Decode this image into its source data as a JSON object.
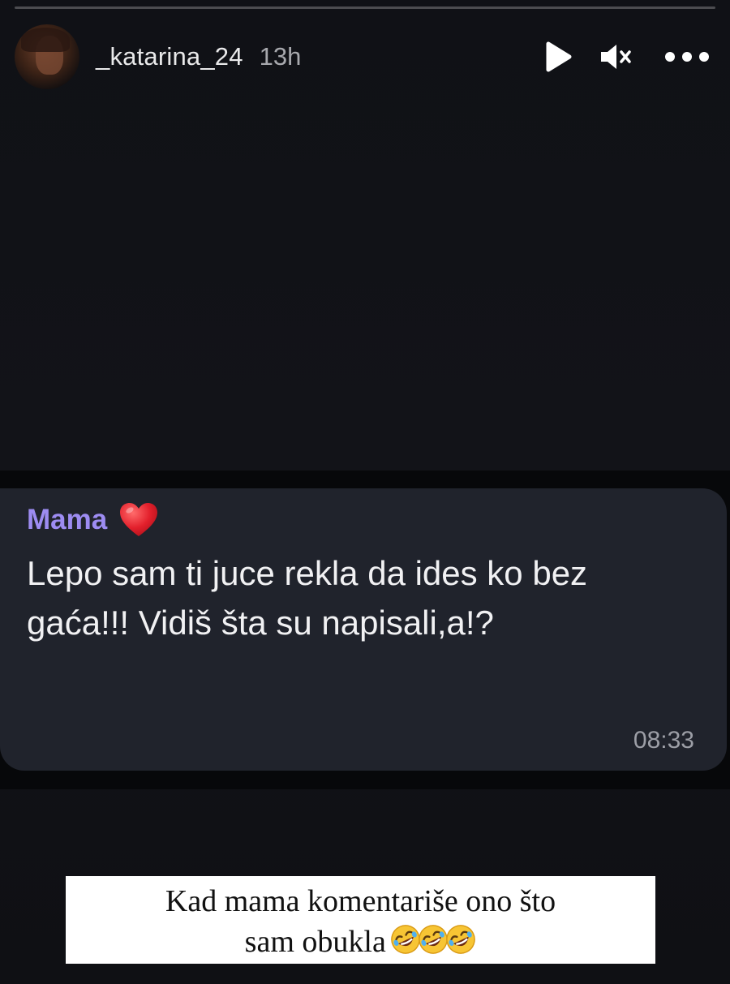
{
  "story": {
    "progress": 0.0
  },
  "header": {
    "username": "_katarina_24",
    "time_ago": "13h",
    "icons": {
      "play": "play-icon",
      "mute": "mute-icon",
      "more": "more-icon"
    }
  },
  "message": {
    "sender": "Mama",
    "sender_icon": "heart-icon",
    "sender_color": "#9d8cf2",
    "text": "Lepo sam ti juce rekla da ides ko bez gaća!!! Vidiš šta su napisali,a!?",
    "timestamp": "08:33"
  },
  "caption": {
    "line1": "Kad mama komentariše ono što",
    "line2": "sam obukla",
    "emojis": [
      "rolling-laughing-emoji",
      "rolling-laughing-emoji",
      "rolling-laughing-emoji"
    ]
  }
}
